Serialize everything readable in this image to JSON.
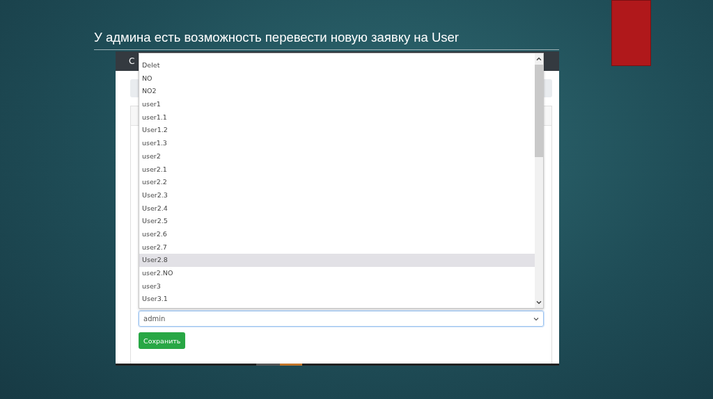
{
  "slide": {
    "title": "У админа есть возможность перевести новую заявку на User"
  },
  "navbar": {
    "brand": "C"
  },
  "dropdown": {
    "options": [
      {
        "label": "Delet",
        "selected": false
      },
      {
        "label": "NO",
        "selected": false
      },
      {
        "label": "NO2",
        "selected": false
      },
      {
        "label": "user1",
        "selected": false
      },
      {
        "label": "user1.1",
        "selected": false
      },
      {
        "label": "User1.2",
        "selected": false
      },
      {
        "label": "user1.3",
        "selected": false
      },
      {
        "label": "user2",
        "selected": false
      },
      {
        "label": "user2.1",
        "selected": false
      },
      {
        "label": "user2.2",
        "selected": false
      },
      {
        "label": "User2.3",
        "selected": false
      },
      {
        "label": "User2.4",
        "selected": false
      },
      {
        "label": "User2.5",
        "selected": false
      },
      {
        "label": "user2.6",
        "selected": false
      },
      {
        "label": "user2.7",
        "selected": false
      },
      {
        "label": "User2.8",
        "selected": true
      },
      {
        "label": "user2.NO",
        "selected": false
      },
      {
        "label": "user3",
        "selected": false
      },
      {
        "label": "User3.1",
        "selected": false
      }
    ]
  },
  "select": {
    "value": "admin"
  },
  "save_button": {
    "label": "Сохранить"
  }
}
